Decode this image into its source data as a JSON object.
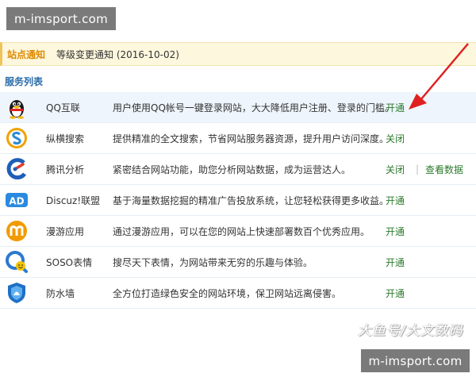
{
  "watermark": {
    "top": "m-imsport.com",
    "bottom": "m-imsport.com",
    "brand": "大鱼号/大文数码"
  },
  "notice": {
    "label": "站点通知",
    "text": "等级变更通知 (2016-10-02)"
  },
  "section": {
    "title": "服务列表"
  },
  "services": [
    {
      "name": "QQ互联",
      "desc": "用户使用QQ帐号一键登录网站，大大降低用户注册、登录的门槛。",
      "action": "开通",
      "icon": "qq-penguin-icon"
    },
    {
      "name": "纵横搜索",
      "desc": "提供精准的全文搜索，节省网站服务器资源，提升用户访问深度。",
      "action": "关闭",
      "icon": "search-s-icon"
    },
    {
      "name": "腾讯分析",
      "desc": "紧密结合网站功能，助您分析网站数据，成为运营达人。",
      "action": "关闭",
      "action2": "查看数据",
      "icon": "analytics-icon"
    },
    {
      "name": "Discuz!联盟",
      "desc": "基于海量数据挖掘的精准广告投放系统，让您轻松获得更多收益。",
      "action": "开通",
      "icon": "ad-icon"
    },
    {
      "name": "漫游应用",
      "desc": "通过漫游应用，可以在您的网站上快速部署数百个优秀应用。",
      "action": "开通",
      "icon": "roaming-m-icon"
    },
    {
      "name": "SOSO表情",
      "desc": "搜尽天下表情，为网站带来无穷的乐趣与体验。",
      "action": "开通",
      "icon": "emoticon-search-icon"
    },
    {
      "name": "防水墙",
      "desc": "全方位打造绿色安全的网站环境，保卫网站远离侵害。",
      "action": "开通",
      "icon": "shield-icon"
    }
  ]
}
